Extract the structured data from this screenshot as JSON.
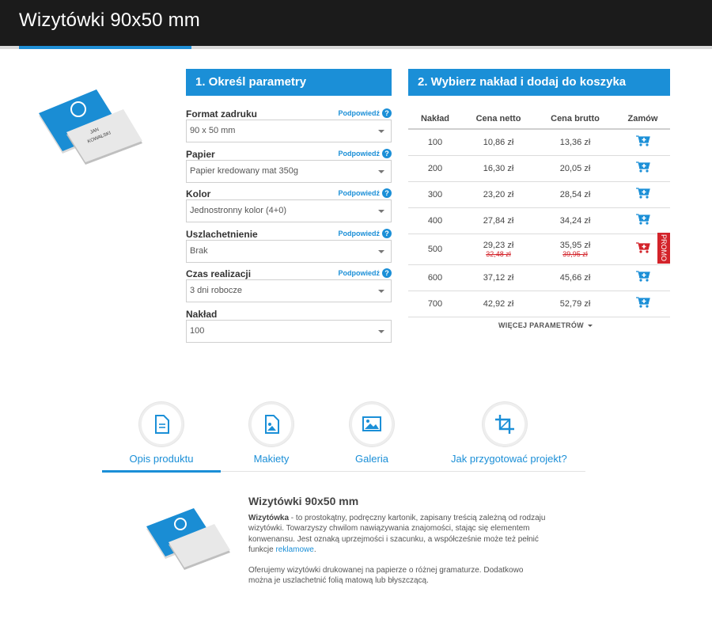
{
  "page": {
    "title": "Wizytówki 90x50 mm"
  },
  "section1": {
    "heading": "1. Określ parametry",
    "help_label": "Podpowiedź",
    "fields": [
      {
        "label": "Format zadruku",
        "value": "90 x 50 mm",
        "has_help": true
      },
      {
        "label": "Papier",
        "value": "Papier kredowany mat 350g",
        "has_help": true
      },
      {
        "label": "Kolor",
        "value": "Jednostronny kolor (4+0)",
        "has_help": true
      },
      {
        "label": "Uszlachetnienie",
        "value": "Brak",
        "has_help": true
      },
      {
        "label": "Czas realizacji",
        "value": "3 dni robocze",
        "has_help": true
      },
      {
        "label": "Nakład",
        "value": "100",
        "has_help": false
      }
    ]
  },
  "section2": {
    "heading": "2. Wybierz nakład i dodaj do koszyka",
    "columns": [
      "Nakład",
      "Cena netto",
      "Cena brutto",
      "Zamów"
    ],
    "rows": [
      {
        "qty": "100",
        "net": "10,86 zł",
        "gross": "13,36 zł"
      },
      {
        "qty": "200",
        "net": "16,30 zł",
        "gross": "20,05 zł"
      },
      {
        "qty": "300",
        "net": "23,20 zł",
        "gross": "28,54 zł"
      },
      {
        "qty": "400",
        "net": "27,84 zł",
        "gross": "34,24 zł"
      },
      {
        "qty": "500",
        "net": "29,23 zł",
        "gross": "35,95 zł",
        "old_net": "32,48 zł",
        "old_gross": "39,95 zł",
        "promo": true
      },
      {
        "qty": "600",
        "net": "37,12 zł",
        "gross": "45,66 zł"
      },
      {
        "qty": "700",
        "net": "42,92 zł",
        "gross": "52,79 zł"
      }
    ],
    "promo_label": "PROMO",
    "more_label": "WIĘCEJ PARAMETRÓW"
  },
  "card": {
    "name_line1": "JAN",
    "name_line2": "KOWALSKI"
  },
  "tabs": [
    {
      "label": "Opis produktu",
      "icon": "document-icon",
      "active": true
    },
    {
      "label": "Makiety",
      "icon": "template-file-icon",
      "active": false
    },
    {
      "label": "Galeria",
      "icon": "image-icon",
      "active": false
    },
    {
      "label": "Jak przygotować projekt?",
      "icon": "crop-icon",
      "active": false
    }
  ],
  "description": {
    "title": "Wizytówki 90x50 mm",
    "p1_bold": "Wizytówka",
    "p1_text": " - to prostokątny, podręczny kartonik, zapisany treścią zależną od rodzaju wizytówki. Towarzyszy chwilom nawiązywania znajomości, stając się elementem konwenansu. Jest oznaką uprzejmości i szacunku, a współcześnie może też pełnić funkcje ",
    "p1_link": "reklamowe",
    "p1_end": ".",
    "p2": "Oferujemy wizytówki drukowanej na papierze o różnej gramaturze. Dodatkowo można je uszlachetnić folią matową lub błyszczącą."
  },
  "colors": {
    "accent": "#1b8fd7",
    "promo": "#d3232a",
    "topbar": "#1b1b1b"
  }
}
